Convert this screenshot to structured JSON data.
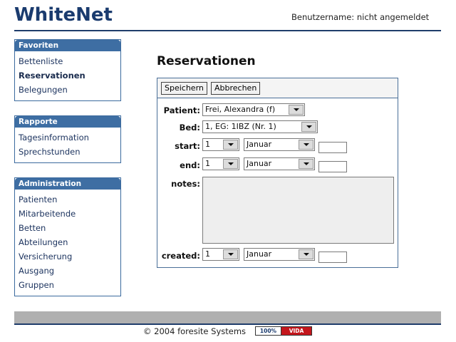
{
  "header": {
    "app_title": "WhiteNet",
    "user_status": "Benutzername: nicht angemeldet"
  },
  "sidebar": {
    "favoriten": {
      "title": "Favoriten",
      "items": [
        "Bettenliste",
        "Reservationen",
        "Belegungen"
      ],
      "active": "Reservationen"
    },
    "rapporte": {
      "title": "Rapporte",
      "items": [
        "Tagesinformation",
        "Sprechstunden"
      ]
    },
    "administration": {
      "title": "Administration",
      "items": [
        "Patienten",
        "Mitarbeitende",
        "Betten",
        "Abteilungen",
        "Versicherung",
        "Ausgang",
        "Gruppen"
      ]
    }
  },
  "main": {
    "page_title": "Reservationen",
    "toolbar": {
      "save_label": "Speichern",
      "cancel_label": "Abbrechen"
    },
    "form": {
      "patient_label": "Patient:",
      "patient_value": "Frei, Alexandra (f)",
      "bed_label": "Bed:",
      "bed_value": "1, EG: 1IBZ (Nr. 1)",
      "start_label": "start:",
      "start_day": "1",
      "start_month": "Januar",
      "end_label": "end:",
      "end_day": "1",
      "end_month": "Januar",
      "notes_label": "notes:",
      "created_label": "created:",
      "created_day": "1",
      "created_month": "Januar"
    }
  },
  "footer": {
    "copyright": "© 2004 foresite Systems",
    "badge_left": "100%",
    "badge_right": "VIDA"
  }
}
